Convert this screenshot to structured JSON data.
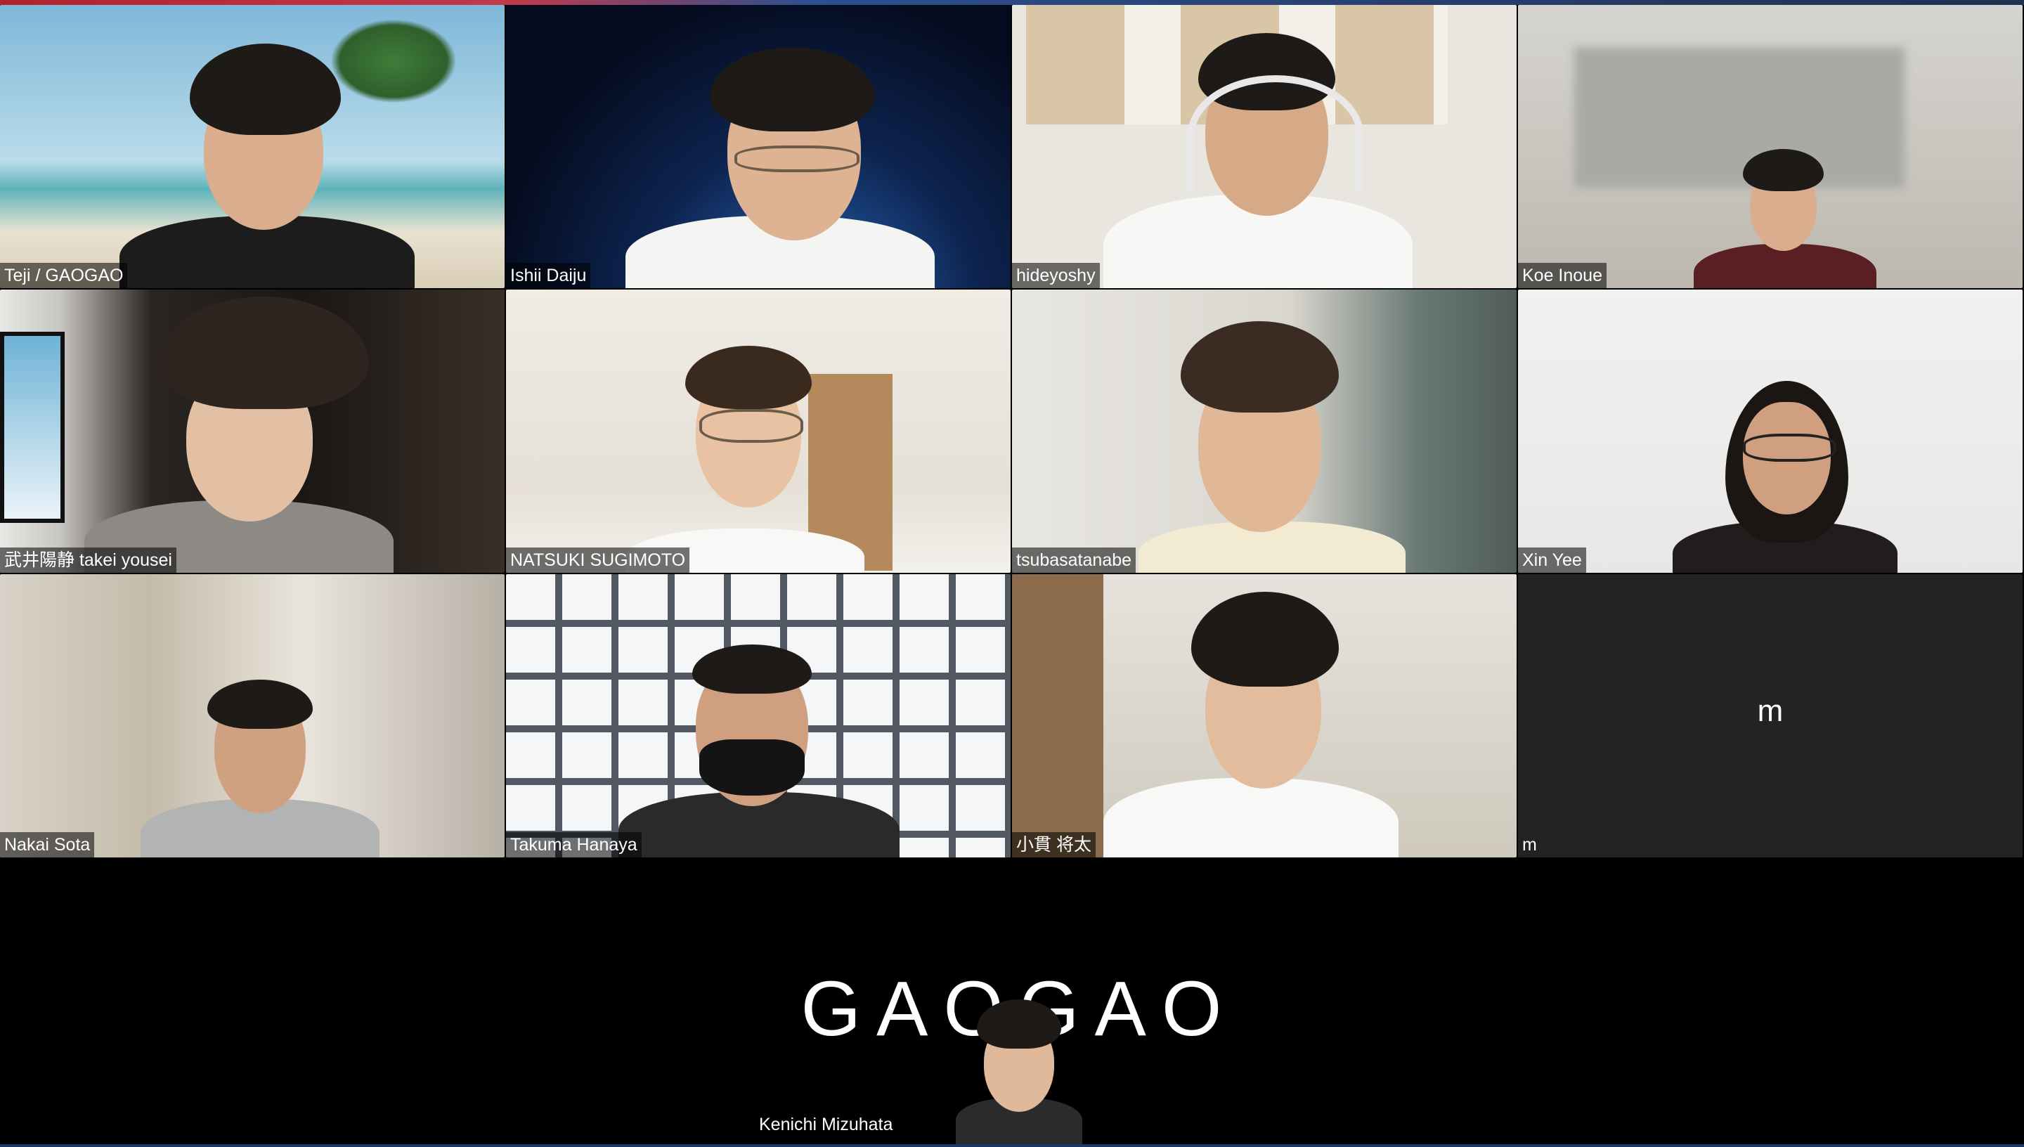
{
  "app": {
    "accent": "#2d8cff"
  },
  "participants": [
    {
      "name": "Teji / GAOGAO"
    },
    {
      "name": "Ishii Daiju"
    },
    {
      "name": "hideyoshy"
    },
    {
      "name": "Koe Inoue"
    },
    {
      "name": "武井陽静 takei yousei"
    },
    {
      "name": "NATSUKI SUGIMOTO"
    },
    {
      "name": "tsubasatanabe"
    },
    {
      "name": "Xin Yee"
    },
    {
      "name": "Nakai Sota"
    },
    {
      "name": "Takuma Hanaya"
    },
    {
      "name": "小貫 将太"
    },
    {
      "name": "m",
      "avatar_letter": "m"
    }
  ],
  "speaker": {
    "name": "Kenichi Mizuhata",
    "background_logo": "GAOGAO"
  }
}
